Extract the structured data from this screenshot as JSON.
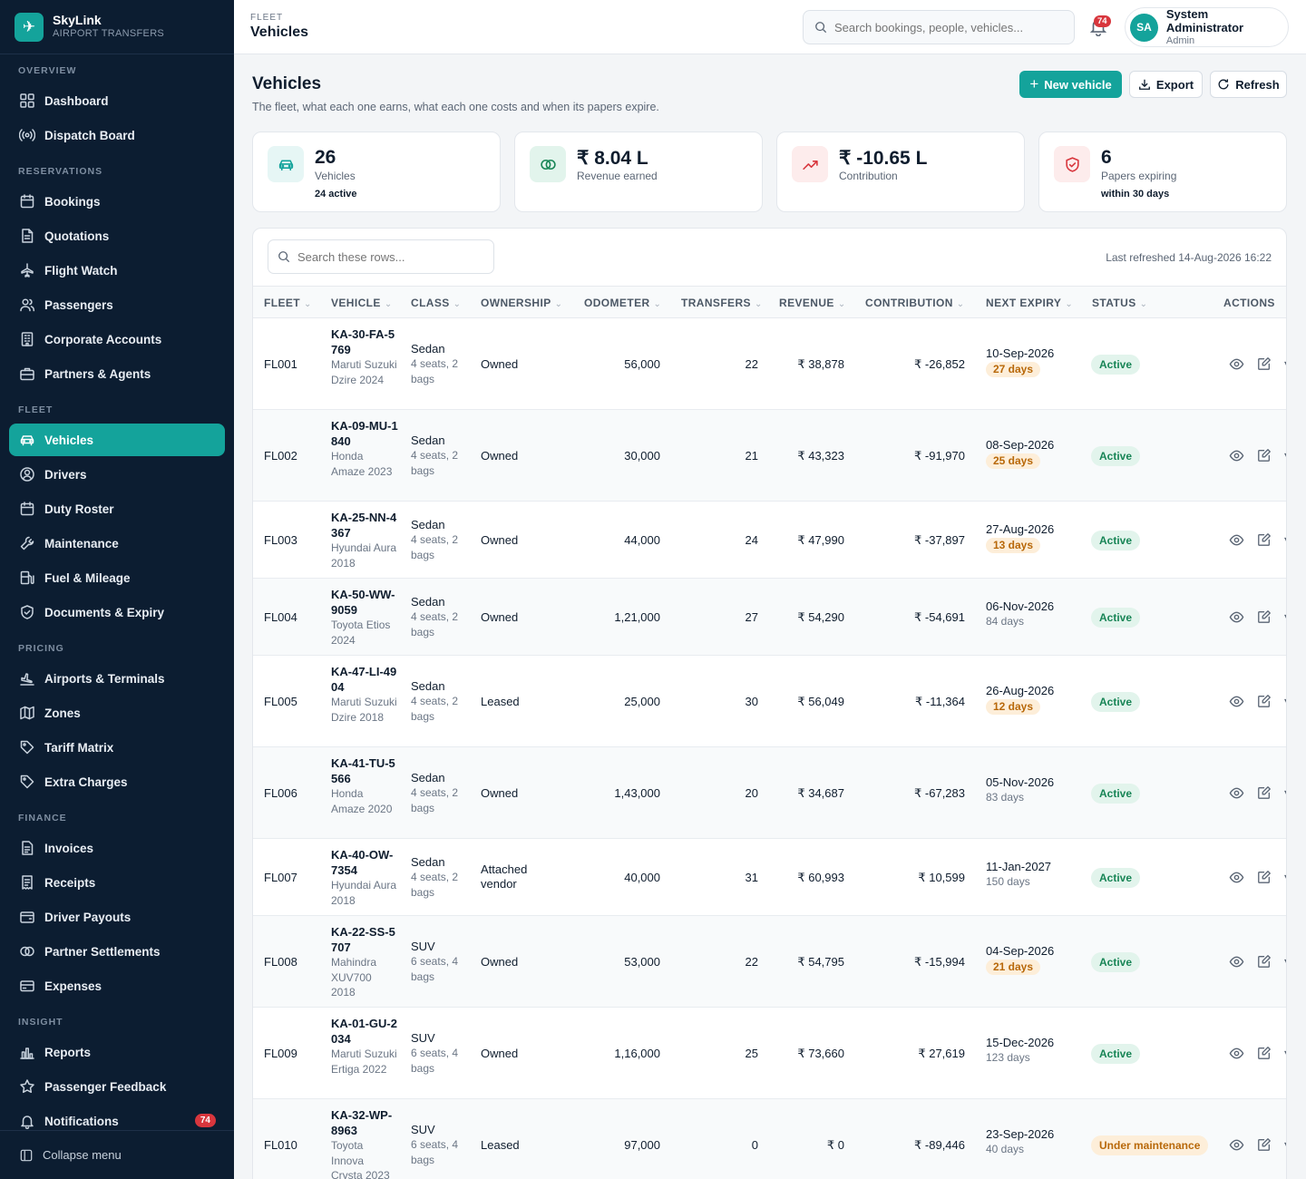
{
  "brand": {
    "name": "SkyLink",
    "subtitle": "AIRPORT TRANSFERS"
  },
  "sidebar": {
    "sections": [
      {
        "label": "OVERVIEW",
        "items": [
          {
            "label": "Dashboard",
            "icon": "grid-icon"
          },
          {
            "label": "Dispatch Board",
            "icon": "broadcast-icon"
          }
        ]
      },
      {
        "label": "RESERVATIONS",
        "items": [
          {
            "label": "Bookings",
            "icon": "calendar-icon"
          },
          {
            "label": "Quotations",
            "icon": "document-icon"
          },
          {
            "label": "Flight Watch",
            "icon": "plane-icon"
          },
          {
            "label": "Passengers",
            "icon": "users-icon"
          },
          {
            "label": "Corporate Accounts",
            "icon": "building-icon"
          },
          {
            "label": "Partners & Agents",
            "icon": "briefcase-icon"
          }
        ]
      },
      {
        "label": "FLEET",
        "items": [
          {
            "label": "Vehicles",
            "icon": "car-icon",
            "active": true
          },
          {
            "label": "Drivers",
            "icon": "driver-icon"
          },
          {
            "label": "Duty Roster",
            "icon": "calendar-icon"
          },
          {
            "label": "Maintenance",
            "icon": "wrench-icon"
          },
          {
            "label": "Fuel & Mileage",
            "icon": "fuel-icon"
          },
          {
            "label": "Documents & Expiry",
            "icon": "shield-icon"
          }
        ]
      },
      {
        "label": "PRICING",
        "items": [
          {
            "label": "Airports & Terminals",
            "icon": "plane-landing-icon"
          },
          {
            "label": "Zones",
            "icon": "map-icon"
          },
          {
            "label": "Tariff Matrix",
            "icon": "tag-icon"
          },
          {
            "label": "Extra Charges",
            "icon": "tag-icon"
          }
        ]
      },
      {
        "label": "FINANCE",
        "items": [
          {
            "label": "Invoices",
            "icon": "invoice-icon"
          },
          {
            "label": "Receipts",
            "icon": "receipt-icon"
          },
          {
            "label": "Driver Payouts",
            "icon": "wallet-icon"
          },
          {
            "label": "Partner Settlements",
            "icon": "coins-icon"
          },
          {
            "label": "Expenses",
            "icon": "card-icon"
          }
        ]
      },
      {
        "label": "INSIGHT",
        "items": [
          {
            "label": "Reports",
            "icon": "bar-chart-icon"
          },
          {
            "label": "Passenger Feedback",
            "icon": "star-icon"
          },
          {
            "label": "Notifications",
            "icon": "bell-icon",
            "badge": "74"
          }
        ]
      }
    ],
    "collapse_label": "Collapse menu"
  },
  "topbar": {
    "section": "FLEET",
    "title": "Vehicles",
    "search_placeholder": "Search bookings, people, vehicles...",
    "notification_count": "74",
    "user": {
      "initials": "SA",
      "name": "System Administrator",
      "role": "Admin"
    }
  },
  "page": {
    "title": "Vehicles",
    "subtitle": "The fleet, what each one earns, what each one costs and when its papers expire.",
    "buttons": {
      "new": "New vehicle",
      "export": "Export",
      "refresh": "Refresh"
    }
  },
  "kpis": [
    {
      "value": "26",
      "label": "Vehicles",
      "note": "24 active",
      "icon": "car-icon",
      "color": "#14a39b",
      "bg": "#e6f6f5"
    },
    {
      "value": "₹ 8.04 L",
      "label": "Revenue earned",
      "note": "",
      "icon": "coins-icon",
      "color": "#188556",
      "bg": "#e2f4ec"
    },
    {
      "value": "₹ -10.65 L",
      "label": "Contribution",
      "note": "",
      "icon": "trend-up-icon",
      "color": "#d8363d",
      "bg": "#fdecec"
    },
    {
      "value": "6",
      "label": "Papers expiring",
      "note": "within 30 days",
      "icon": "shield-icon",
      "color": "#d8363d",
      "bg": "#fdecec"
    }
  ],
  "table": {
    "search_placeholder": "Search these rows...",
    "last_refreshed": "Last refreshed 14-Aug-2026 16:22",
    "columns": [
      "FLEET",
      "VEHICLE",
      "CLASS",
      "OWNERSHIP",
      "ODOMETER",
      "TRANSFERS",
      "REVENUE",
      "CONTRIBUTION",
      "NEXT EXPIRY",
      "STATUS",
      "ACTIONS"
    ],
    "rows": [
      {
        "fleet": "FL001",
        "reg": "KA-30-FA-5769",
        "model": "Maruti Suzuki Dzire 2024",
        "class": "Sedan",
        "class_desc": "4 seats, 2 bags",
        "ownership": "Owned",
        "odometer": "56,000",
        "transfers": "22",
        "revenue": "₹ 38,878",
        "contribution": "₹ -26,852",
        "expiry_date": "10-Sep-2026",
        "expiry_days": "27 days",
        "expiry_warn": true,
        "status": "Active"
      },
      {
        "fleet": "FL002",
        "reg": "KA-09-MU-1840",
        "model": "Honda Amaze 2023",
        "class": "Sedan",
        "class_desc": "4 seats, 2 bags",
        "ownership": "Owned",
        "odometer": "30,000",
        "transfers": "21",
        "revenue": "₹ 43,323",
        "contribution": "₹ -91,970",
        "expiry_date": "08-Sep-2026",
        "expiry_days": "25 days",
        "expiry_warn": true,
        "status": "Active"
      },
      {
        "fleet": "FL003",
        "reg": "KA-25-NN-4367",
        "model": "Hyundai Aura 2018",
        "class": "Sedan",
        "class_desc": "4 seats, 2 bags",
        "ownership": "Owned",
        "odometer": "44,000",
        "transfers": "24",
        "revenue": "₹ 47,990",
        "contribution": "₹ -37,897",
        "expiry_date": "27-Aug-2026",
        "expiry_days": "13 days",
        "expiry_warn": true,
        "status": "Active"
      },
      {
        "fleet": "FL004",
        "reg": "KA-50-WW-9059",
        "model": "Toyota Etios 2024",
        "class": "Sedan",
        "class_desc": "4 seats, 2 bags",
        "ownership": "Owned",
        "odometer": "1,21,000",
        "transfers": "27",
        "revenue": "₹ 54,290",
        "contribution": "₹ -54,691",
        "expiry_date": "06-Nov-2026",
        "expiry_days": "84 days",
        "expiry_warn": false,
        "status": "Active"
      },
      {
        "fleet": "FL005",
        "reg": "KA-47-LI-4904",
        "model": "Maruti Suzuki Dzire 2018",
        "class": "Sedan",
        "class_desc": "4 seats, 2 bags",
        "ownership": "Leased",
        "odometer": "25,000",
        "transfers": "30",
        "revenue": "₹ 56,049",
        "contribution": "₹ -11,364",
        "expiry_date": "26-Aug-2026",
        "expiry_days": "12 days",
        "expiry_warn": true,
        "status": "Active"
      },
      {
        "fleet": "FL006",
        "reg": "KA-41-TU-5566",
        "model": "Honda Amaze 2020",
        "class": "Sedan",
        "class_desc": "4 seats, 2 bags",
        "ownership": "Owned",
        "odometer": "1,43,000",
        "transfers": "20",
        "revenue": "₹ 34,687",
        "contribution": "₹ -67,283",
        "expiry_date": "05-Nov-2026",
        "expiry_days": "83 days",
        "expiry_warn": false,
        "status": "Active"
      },
      {
        "fleet": "FL007",
        "reg": "KA-40-OW-7354",
        "model": "Hyundai Aura 2018",
        "class": "Sedan",
        "class_desc": "4 seats, 2 bags",
        "ownership": "Attached vendor",
        "odometer": "40,000",
        "transfers": "31",
        "revenue": "₹ 60,993",
        "contribution": "₹ 10,599",
        "expiry_date": "11-Jan-2027",
        "expiry_days": "150 days",
        "expiry_warn": false,
        "status": "Active"
      },
      {
        "fleet": "FL008",
        "reg": "KA-22-SS-5707",
        "model": "Mahindra XUV700 2018",
        "class": "SUV",
        "class_desc": "6 seats, 4 bags",
        "ownership": "Owned",
        "odometer": "53,000",
        "transfers": "22",
        "revenue": "₹ 54,795",
        "contribution": "₹ -15,994",
        "expiry_date": "04-Sep-2026",
        "expiry_days": "21 days",
        "expiry_warn": true,
        "status": "Active"
      },
      {
        "fleet": "FL009",
        "reg": "KA-01-GU-2034",
        "model": "Maruti Suzuki Ertiga 2022",
        "class": "SUV",
        "class_desc": "6 seats, 4 bags",
        "ownership": "Owned",
        "odometer": "1,16,000",
        "transfers": "25",
        "revenue": "₹ 73,660",
        "contribution": "₹ 27,619",
        "expiry_date": "15-Dec-2026",
        "expiry_days": "123 days",
        "expiry_warn": false,
        "status": "Active"
      },
      {
        "fleet": "FL010",
        "reg": "KA-32-WP-8963",
        "model": "Toyota Innova Crysta 2023",
        "class": "SUV",
        "class_desc": "6 seats, 4 bags",
        "ownership": "Leased",
        "odometer": "97,000",
        "transfers": "0",
        "revenue": "₹ 0",
        "contribution": "₹ -89,446",
        "expiry_date": "23-Sep-2026",
        "expiry_days": "40 days",
        "expiry_warn": false,
        "status": "Under maintenance"
      }
    ]
  }
}
